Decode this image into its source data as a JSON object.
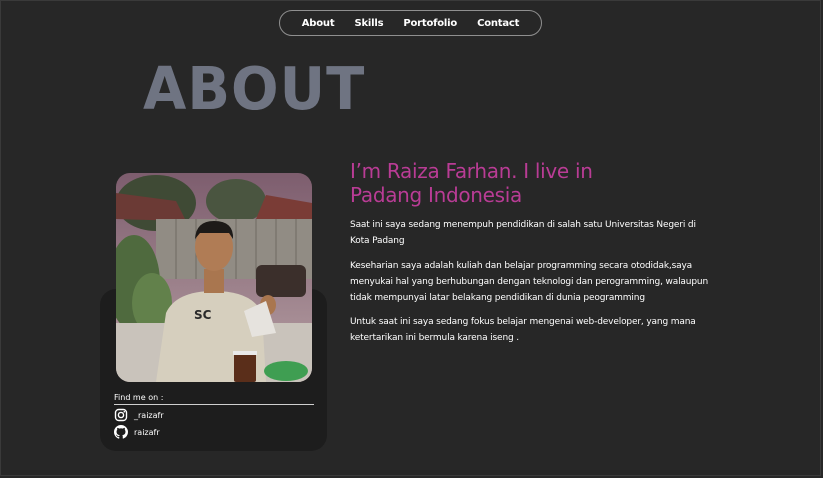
{
  "nav": {
    "items": [
      "About",
      "Skills",
      "Portofolio",
      "Contact"
    ]
  },
  "about": {
    "heading": "ABOUT",
    "intro": "I’m Raiza Farhan. I live in Padang Indonesia",
    "paragraphs": [
      "Saat ini saya sedang menempuh pendidikan di salah satu Universitas Negeri di Kota Padang",
      "Keseharian saya adalah kuliah dan belajar programming secara otodidak,saya menyukai hal yang berhubungan dengan teknologi dan perogramming, walaupun tidak mempunyai latar belakang pendidikan di dunia peogramming",
      "Untuk saat ini saya sedang fokus belajar mengenai web-developer, yang mana ketertarikan ini bermula karena iseng ."
    ]
  },
  "profile": {
    "find_me_label": "Find me on :",
    "socials": [
      {
        "icon": "instagram-icon",
        "handle": "_raizafr"
      },
      {
        "icon": "github-icon",
        "handle": "raizafr"
      }
    ]
  },
  "colors": {
    "background": "#272727",
    "heading": "#6f7482",
    "accent": "#b93c95",
    "card": "#1d1d1d"
  }
}
